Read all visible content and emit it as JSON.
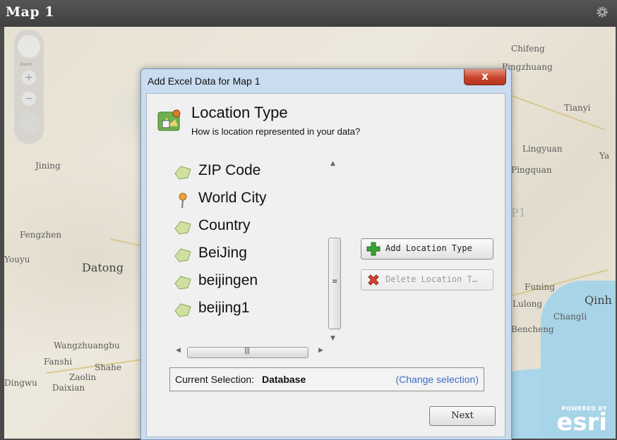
{
  "window": {
    "title": "Map 1",
    "settings_icon": "gear-icon"
  },
  "map": {
    "zoom_label": "Zoom",
    "places": [
      "Chifeng",
      "Pingzhuang",
      "Tianyi",
      "Lingyuan",
      "Pingquan",
      "Jining",
      "Fengzhen",
      "Youyu",
      "Datong",
      "Funing",
      "Lulong",
      "Changli",
      "Bencheng",
      "Qinh",
      "Wangzhuangbu",
      "Fanshi",
      "Shahe",
      "Zaolin",
      "Daixian",
      "Dingwu",
      "Ya",
      "P1"
    ],
    "attribution": {
      "powered_by": "POWERED BY",
      "brand": "esri"
    }
  },
  "dialog": {
    "title": "Add Excel Data for Map 1",
    "close_label": "x",
    "heading": "Location Type",
    "subheading": "How is location represented in your data?",
    "location_types": [
      {
        "label": "ZIP Code",
        "icon": "polygon-icon"
      },
      {
        "label": "World City",
        "icon": "pushpin-icon"
      },
      {
        "label": "Country",
        "icon": "polygon-icon"
      },
      {
        "label": "BeiJing",
        "icon": "polygon-icon"
      },
      {
        "label": "beijingen",
        "icon": "polygon-icon"
      },
      {
        "label": "beijing1",
        "icon": "polygon-icon"
      }
    ],
    "add_button": "Add Location Type",
    "delete_button": "Delete Location T…",
    "current_selection_label": "Current Selection:",
    "current_selection_value": "Database",
    "change_selection_link": "(Change selection)",
    "next_button": "Next",
    "colors": {
      "accent_green": "#3aa336",
      "delete_red": "#d9472f",
      "link_blue": "#3c6fc5"
    }
  }
}
